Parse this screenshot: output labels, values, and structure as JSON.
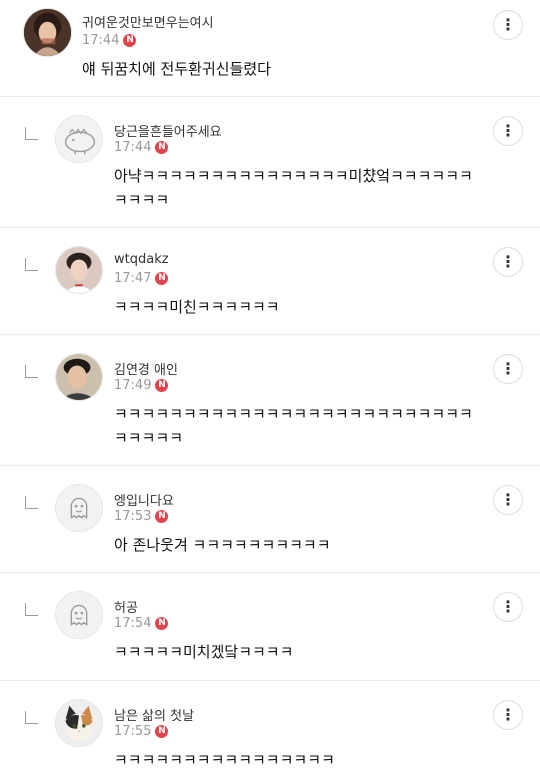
{
  "comments": [
    {
      "nickname": "귀여운것만보면우는여시",
      "time": "17:44",
      "badge": "N",
      "text": "얘 뒤꿈치에 전두환귀신들렸다",
      "avatar_icon": "photo-avatar-woman",
      "more_icon": "more-vertical-icon"
    },
    {
      "nickname": "당근을흔들어주세요",
      "time": "17:44",
      "badge": "N",
      "text": "아냑ㅋㅋㅋㅋㅋㅋㅋㅋㅋㅋㅋㅋㅋㅋㅋ미챴엌ㅋㅋㅋㅋㅋㅋㅋㅋㅋㅋ",
      "avatar_icon": "dinosaur-default-avatar",
      "reply_icon": "reply-arrow-icon",
      "more_icon": "more-vertical-icon"
    },
    {
      "nickname": "wtqdakz",
      "time": "17:47",
      "badge": "N",
      "text": "ㅋㅋㅋㅋ미친ㅋㅋㅋㅋㅋㅋ",
      "avatar_icon": "photo-avatar-man",
      "reply_icon": "reply-arrow-icon",
      "more_icon": "more-vertical-icon"
    },
    {
      "nickname": "김연경 애인",
      "time": "17:49",
      "badge": "N",
      "text": "ㅋㅋㅋㅋㅋㅋㅋㅋㅋㅋㅋㅋㅋㅋㅋㅋㅋㅋㅋㅋㅋㅋㅋㅋㅋㅋㅋㅋㅋㅋㅋ",
      "avatar_icon": "photo-avatar-man",
      "reply_icon": "reply-arrow-icon",
      "more_icon": "more-vertical-icon"
    },
    {
      "nickname": "엥입니다요",
      "time": "17:53",
      "badge": "N",
      "text": "아 존나웃겨 ㅋㅋㅋㅋㅋㅋㅋㅋㅋㅋ",
      "avatar_icon": "ghost-default-avatar",
      "reply_icon": "reply-arrow-icon",
      "more_icon": "more-vertical-icon"
    },
    {
      "nickname": "허공",
      "time": "17:54",
      "badge": "N",
      "text": "ㅋㅋㅋㅋㅋ미치겠닼ㅋㅋㅋㅋ",
      "avatar_icon": "ghost-default-avatar",
      "reply_icon": "reply-arrow-icon",
      "more_icon": "more-vertical-icon"
    },
    {
      "nickname": "남은 삶의 첫날",
      "time": "17:55",
      "badge": "N",
      "text": "ㅋㅋㅋㅋㅋㅋㅋㅋㅋㅋㅋㅋㅋㅋㅋㅋ",
      "avatar_icon": "cat-photo-avatar",
      "reply_icon": "reply-arrow-icon",
      "more_icon": "more-vertical-icon"
    }
  ],
  "colors": {
    "badge": "#e2434c",
    "divider": "#ececec",
    "time": "#999999"
  }
}
